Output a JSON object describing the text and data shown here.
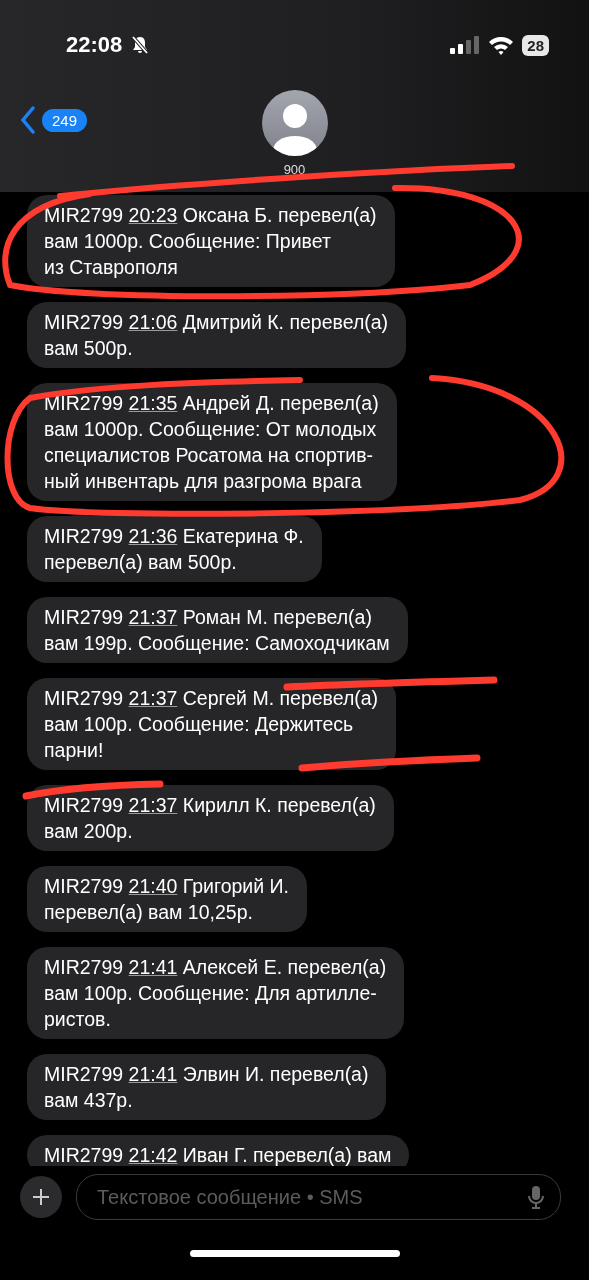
{
  "status_bar": {
    "time": "22:08",
    "battery": "28"
  },
  "header": {
    "unread_count": "249",
    "contact": "900"
  },
  "messages": [
    {
      "code": "MIR2799",
      "time": "20:23",
      "lines": [
        "Оксана Б. перевел(а)",
        "вам 1000р. Сообщение: Привет",
        "из Ставрополя"
      ]
    },
    {
      "code": "MIR2799",
      "time": "21:06",
      "lines": [
        "Дмитрий К. перевел(а)",
        "вам 500р."
      ]
    },
    {
      "code": "MIR2799",
      "time": "21:35",
      "lines": [
        "Андрей Д. перевел(а)",
        "вам 1000р. Сообщение: От молодых",
        "специалистов Росатома на спортив-",
        "ный инвентарь для разгрома врага"
      ]
    },
    {
      "code": "MIR2799",
      "time": "21:36",
      "lines": [
        "Екатерина Ф.",
        "перевел(а) вам 500р."
      ]
    },
    {
      "code": "MIR2799",
      "time": "21:37",
      "lines": [
        "Роман М. перевел(а)",
        "вам 199р. Сообщение: Самоходчикам"
      ]
    },
    {
      "code": "MIR2799",
      "time": "21:37",
      "lines": [
        "Сергей М. перевел(а)",
        "вам 100р. Сообщение: Держитесь",
        "парни!"
      ]
    },
    {
      "code": "MIR2799",
      "time": "21:37",
      "lines": [
        "Кирилл К. перевел(а)",
        "вам 200р."
      ]
    },
    {
      "code": "MIR2799",
      "time": "21:40",
      "lines": [
        "Григорий И.",
        "перевел(а) вам 10,25р."
      ]
    },
    {
      "code": "MIR2799",
      "time": "21:41",
      "lines": [
        "Алексей Е. перевел(а)",
        "вам 100р. Сообщение: Для артилле-",
        "ристов."
      ]
    },
    {
      "code": "MIR2799",
      "time": "21:41",
      "lines": [
        "Элвин И. перевел(а)",
        "вам 437р."
      ]
    },
    {
      "code": "MIR2799",
      "time": "21:42",
      "lines": [
        "Иван Г. перевел(а) вам"
      ]
    }
  ],
  "composer": {
    "placeholder": "Текстовое сообщение • SMS"
  }
}
